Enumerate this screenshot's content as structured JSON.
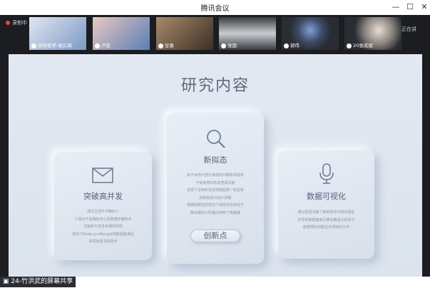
{
  "window": {
    "title": "腾讯会议"
  },
  "recording": {
    "label": "录制中"
  },
  "participants": [
    {
      "name": "答辩老师-张久辉"
    },
    {
      "name": "卢安"
    },
    {
      "name": "甘勇"
    },
    {
      "name": "张国"
    },
    {
      "name": "郭伟"
    },
    {
      "name": "20张成斌"
    }
  ],
  "more_label": "正在讲",
  "slide": {
    "title": "研究内容",
    "cards": [
      {
        "title": "突破高并发",
        "lines": [
          "通过主流与书籍的人",
          "介绍对于后端技术以及数据存储技术",
          "方面有不定技术相的研究",
          "发现了Node.js+MongoDB能最能满足",
          "本项目需求的技术"
        ]
      },
      {
        "title": "新拟态",
        "lines": [
          "由于目前大部分系统的UI都有待提高",
          "于是有意识的去查阅文献",
          "发现了近两年在全球掀起新一轮在新",
          "的新拟态UI设计风格",
          "根据新颖性的想这个目前仅仅存在于",
          "移动端的UI风格应用到了电脑端"
        ],
        "button": "创新点"
      },
      {
        "title": "数据可视化",
        "lines": [
          "通过查阅文献了解到现有可视化团队",
          "开发的数据面板引擎有着强大的实力",
          "能够很好的胜任本项目的工作"
        ]
      }
    ]
  },
  "share_label": "24-竹洪武的屏幕共享"
}
